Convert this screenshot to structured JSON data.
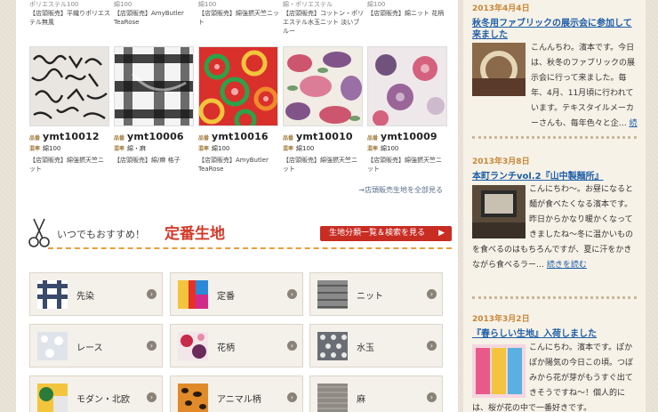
{
  "top_row": [
    {
      "line1": "【店頭販売】平織りポリエステル無風"
    },
    {
      "line1": "【店頭販売】AmyButler TeaRose"
    },
    {
      "line1": "【店頭販売】綿強撚天竺ニット"
    },
    {
      "line1": "【店頭販売】コットン・ポリエステル水玉ニット 淡いブルー"
    },
    {
      "line1": "【店頭販売】綿ニット 花柄"
    }
  ],
  "top_row_partial": [
    "ポリエステル100",
    "綿100",
    "綿100",
    "綿・ポリエステル",
    "綿100"
  ],
  "products": [
    {
      "code_label": "品番",
      "code": "ymt10012",
      "mat_label": "混率",
      "material": "綿100",
      "desc": "【店頭販売】綿強撚天竺ニット"
    },
    {
      "code_label": "品番",
      "code": "ymt10006",
      "mat_label": "混率",
      "material": "綿・麻",
      "desc": "【店頭販売】綿/麻 格子"
    },
    {
      "code_label": "品番",
      "code": "ymt10016",
      "mat_label": "混率",
      "material": "綿100",
      "desc": "【店頭販売】AmyButler TeaRose"
    },
    {
      "code_label": "品番",
      "code": "ymt10010",
      "mat_label": "混率",
      "material": "綿100",
      "desc": "【店頭販売】綿強撚天竺ニット"
    },
    {
      "code_label": "品番",
      "code": "ymt10009",
      "mat_label": "混率",
      "material": "綿100",
      "desc": "【店頭販売】綿強撚天竺ニット"
    }
  ],
  "see_all": "→店頭販売生地を全部見る",
  "section": {
    "small": "いつでもおすすめ！",
    "big": "定番生地",
    "button": "生地分類一覧＆検索を見る",
    "button_arrow": "▶"
  },
  "categories": [
    {
      "label": "先染"
    },
    {
      "label": "定番"
    },
    {
      "label": "ニット"
    },
    {
      "label": "レース"
    },
    {
      "label": "花柄"
    },
    {
      "label": "水玉"
    },
    {
      "label": "モダン・北欧"
    },
    {
      "label": "アニマル柄"
    },
    {
      "label": "麻"
    }
  ],
  "go_glyph": "›",
  "sidebar": {
    "posts": [
      {
        "date": "2013年4月4日",
        "title": "秋冬用ファブリックの展示会に参加して来ました",
        "body": "こんんちわ。濱本です。今日は、秋冬のファブリックの展示会に行って来ました。毎年、4月、11月頃に行われています。テキスタイルメーカーさんも、毎年色々と企…",
        "more": "続きを読む"
      },
      {
        "date": "2013年3月8日",
        "title": "本町ランチvol.2『山中製麺所』",
        "body": "こんにちわ～。お昼になると麺が食べたくなる濱本です。昨日からかなり暖かくなってきましたね～冬に温かいものを食べるのはもちろんですが、夏に汗をかきながら食べるラー…",
        "more": "続きを読む"
      },
      {
        "date": "2013年3月2日",
        "title": "『春らしい生地』入荷しました",
        "body": "こんにちわ。濱本です。ぽかぽか陽気の今日この頃。つぼみから花が芽がもうすぐ出てきそうですね～！個人的には、桜が花の中で一番好きです。",
        "more": ""
      }
    ]
  }
}
